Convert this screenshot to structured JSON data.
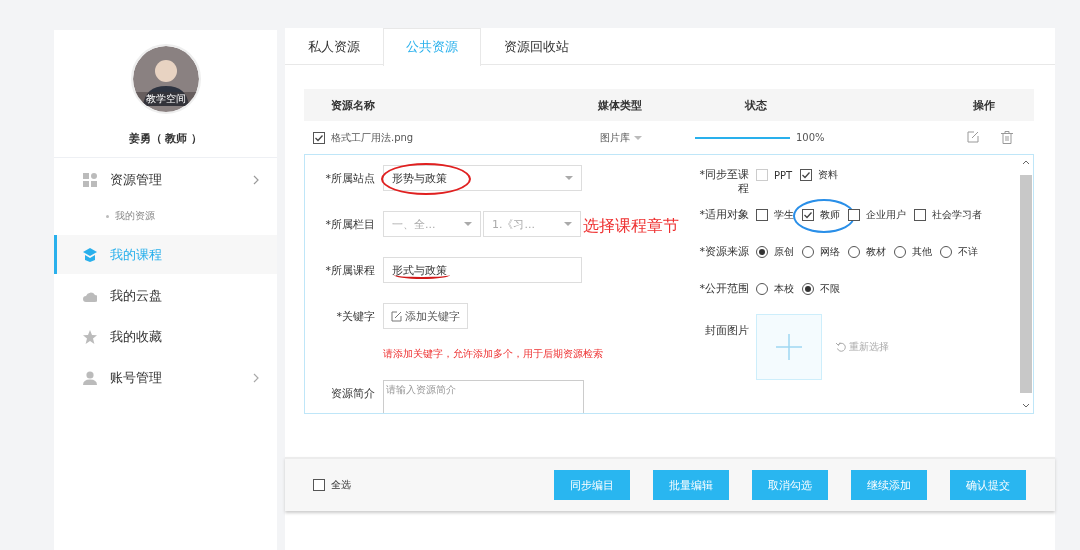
{
  "sidebar": {
    "profile": {
      "avatar_caption": "教学空间",
      "name": "姜勇（ 教师 ）"
    },
    "items": [
      {
        "label": "资源管理",
        "selected": false,
        "expanded": true,
        "children": [
          {
            "label": "我的资源",
            "selected": false
          }
        ]
      },
      {
        "label": "我的课程",
        "selected": true
      },
      {
        "label": "我的云盘",
        "selected": false
      },
      {
        "label": "我的收藏",
        "selected": false
      },
      {
        "label": "账号管理",
        "selected": false,
        "expanded": false
      }
    ]
  },
  "tabs": [
    {
      "label": "私人资源",
      "selected": false
    },
    {
      "label": "公共资源",
      "selected": true
    },
    {
      "label": "资源回收站",
      "selected": false
    }
  ],
  "table": {
    "columns": [
      "资源名称",
      "媒体类型",
      "状态",
      "操作"
    ],
    "rows": [
      {
        "checked": true,
        "name": "格式工厂用法.png",
        "media_type": "图片库",
        "level": 1.0,
        "reading": "100%"
      }
    ]
  },
  "form": {
    "left": [
      {
        "kind": "select",
        "label": "*所属站点",
        "values": [
          {
            "text": "形势与政策",
            "disabled": false
          }
        ],
        "circled": true
      },
      {
        "kind": "select",
        "label": "*所属栏目",
        "values": [
          {
            "text": "一、全...",
            "disabled": true
          },
          {
            "text": "1.《习...",
            "disabled": true
          }
        ],
        "note": "选择课程章节"
      },
      {
        "kind": "text",
        "label": "*所属课程",
        "value": "形式与政策",
        "underlined": true
      },
      {
        "kind": "keyword",
        "label": "*关键字",
        "button": "添加关键字",
        "hint": "请添加关键字，允许添加多个，用于后期资源检索"
      },
      {
        "kind": "textarea",
        "label": "资源简介",
        "placeholder": "请输入资源简介"
      }
    ],
    "right": [
      {
        "kind": "checkboxes",
        "label": "*同步至课程",
        "options": [
          {
            "label": "PPT",
            "checked": false,
            "disabled": true
          },
          {
            "label": "资料",
            "checked": true,
            "disabled": false
          }
        ]
      },
      {
        "kind": "checkboxes",
        "label": "*适用对象",
        "options": [
          {
            "label": "学生",
            "checked": false,
            "disabled": false
          },
          {
            "label": "教师",
            "checked": true,
            "disabled": false,
            "circled": true
          },
          {
            "label": "企业用户",
            "checked": false,
            "disabled": false
          },
          {
            "label": "社会学习者",
            "checked": false,
            "disabled": false
          }
        ]
      },
      {
        "kind": "radios",
        "label": "*资源来源",
        "options": [
          {
            "label": "原创",
            "selected": true
          },
          {
            "label": "网络",
            "selected": false
          },
          {
            "label": "教材",
            "selected": false
          },
          {
            "label": "其他",
            "selected": false
          },
          {
            "label": "不详",
            "selected": false
          }
        ]
      },
      {
        "kind": "radios",
        "label": "*公开范围",
        "options": [
          {
            "label": "本校",
            "selected": false
          },
          {
            "label": "不限",
            "selected": true
          }
        ]
      },
      {
        "kind": "upload",
        "label": "封面图片",
        "reselect": "重新选择"
      }
    ]
  },
  "footer": {
    "select_all": {
      "label": "全选",
      "checked": false
    },
    "buttons": [
      "同步编目",
      "批量编辑",
      "取消勾选",
      "继续添加",
      "确认提交"
    ]
  }
}
